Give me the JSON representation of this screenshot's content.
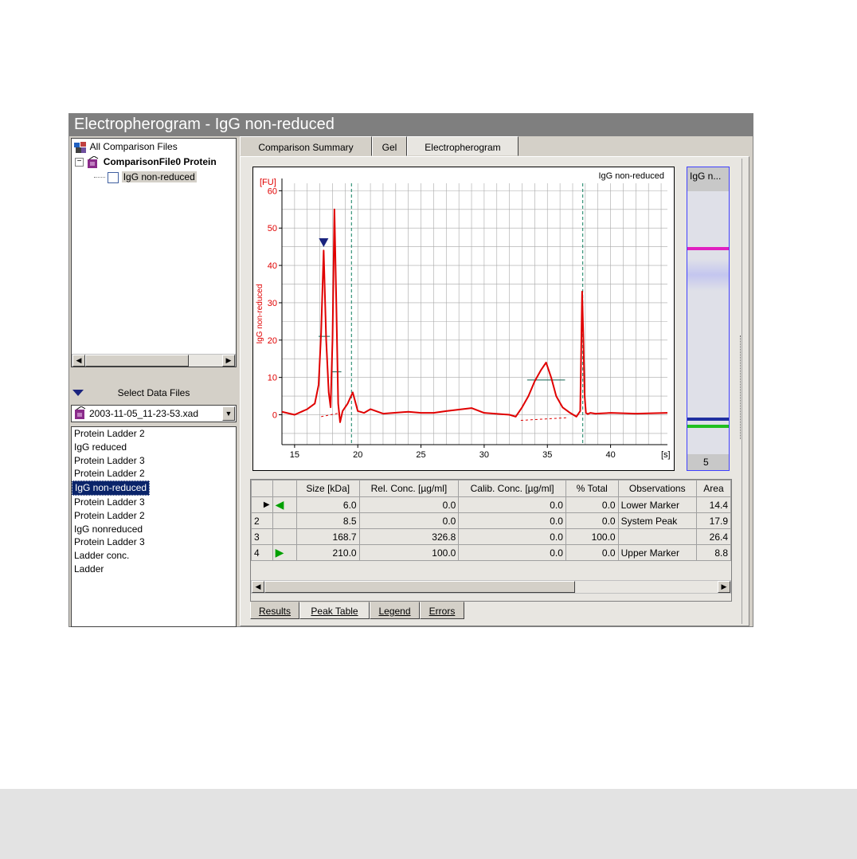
{
  "window": {
    "title": "Electropherogram - IgG non-reduced"
  },
  "tree": {
    "root": "All Comparison Files",
    "file": "ComparisonFile0 Protein",
    "sample": "IgG non-reduced"
  },
  "select_data_files": {
    "label": "Select Data Files",
    "file_value": "2003-11-05_11-23-53.xad"
  },
  "file_list": [
    "Protein Ladder 2",
    "IgG reduced",
    "Protein Ladder 3",
    "Protein Ladder 2",
    "IgG non-reduced",
    "Protein Ladder 3",
    "Protein Ladder 2",
    "IgG nonreduced",
    "Protein Ladder 3",
    "Ladder conc.",
    "Ladder"
  ],
  "file_list_selected_index": 4,
  "tabs": [
    "Comparison Summary",
    "Gel",
    "Electropherogram"
  ],
  "active_tab": "Electropherogram",
  "chart_data": {
    "type": "line",
    "sample_name": "IgG non-reduced",
    "y_unit": "[FU]",
    "x_unit": "[s]",
    "ylabel": "IgG non-reduced",
    "xlim": [
      14,
      44.5
    ],
    "ylim": [
      -8,
      62
    ],
    "x_ticks": [
      15,
      20,
      25,
      30,
      35,
      40
    ],
    "y_ticks": [
      0,
      10,
      20,
      30,
      40,
      50,
      60
    ],
    "grid": true,
    "x": [
      14.0,
      15.0,
      16.0,
      16.6,
      16.9,
      17.1,
      17.3,
      17.5,
      17.7,
      17.85,
      18.0,
      18.15,
      18.3,
      18.45,
      18.6,
      18.8,
      19.2,
      19.6,
      20.0,
      20.5,
      21.0,
      22.0,
      24.0,
      25.0,
      26.0,
      27.0,
      29.0,
      30.0,
      32.0,
      32.5,
      33.0,
      33.5,
      34.0,
      34.5,
      34.9,
      35.3,
      35.7,
      36.2,
      36.8,
      37.3,
      37.6,
      37.75,
      37.85,
      37.95,
      38.05,
      38.2,
      38.4,
      38.8,
      40.0,
      42.0,
      44.5
    ],
    "values": [
      0.8,
      0.0,
      1.5,
      3.0,
      8.0,
      22.0,
      44.0,
      20.0,
      6.0,
      2.0,
      20.0,
      55.0,
      30.0,
      3.0,
      -2.0,
      1.0,
      3.0,
      6.0,
      1.0,
      0.5,
      1.5,
      0.3,
      0.8,
      0.5,
      0.5,
      1.0,
      1.8,
      0.5,
      0.0,
      -0.5,
      2.0,
      5.0,
      9.0,
      12.0,
      14.0,
      10.0,
      5.0,
      2.0,
      0.5,
      -0.5,
      1.0,
      33.0,
      20.0,
      5.0,
      0.5,
      0.2,
      0.5,
      0.3,
      0.5,
      0.3,
      0.5
    ],
    "markers": [
      {
        "x": 17.3,
        "y": 46
      }
    ],
    "vertical_lines_x": [
      19.5,
      37.8
    ]
  },
  "gel_lane": {
    "label": "IgG n...",
    "number": "5"
  },
  "peak_table": {
    "columns": [
      "",
      "",
      "Size [kDa]",
      "Rel. Conc. [µg/ml]",
      "Calib. Conc. [µg/ml]",
      "% Total",
      "Observations",
      "Area"
    ],
    "rows": [
      {
        "id": "",
        "marker": "left",
        "size": "6.0",
        "rel": "0.0",
        "calib": "0.0",
        "total": "0.0",
        "obs": "Lower Marker",
        "area": "14.4"
      },
      {
        "id": "2",
        "marker": "",
        "size": "8.5",
        "rel": "0.0",
        "calib": "0.0",
        "total": "0.0",
        "obs": "System Peak",
        "area": "17.9"
      },
      {
        "id": "3",
        "marker": "",
        "size": "168.7",
        "rel": "326.8",
        "calib": "0.0",
        "total": "100.0",
        "obs": "",
        "area": "26.4"
      },
      {
        "id": "4",
        "marker": "right",
        "size": "210.0",
        "rel": "100.0",
        "calib": "0.0",
        "total": "0.0",
        "obs": "Upper Marker",
        "area": "8.8"
      }
    ]
  },
  "bottom_tabs": [
    "Results",
    "Peak Table",
    "Legend",
    "Errors"
  ],
  "active_bottom_tab": "Peak Table",
  "colors": {
    "trace": "#e00000",
    "grid": "#a8a8a8",
    "axis_text": "#e00000",
    "marker_green": "#00a000",
    "selection": "#0a246a"
  }
}
